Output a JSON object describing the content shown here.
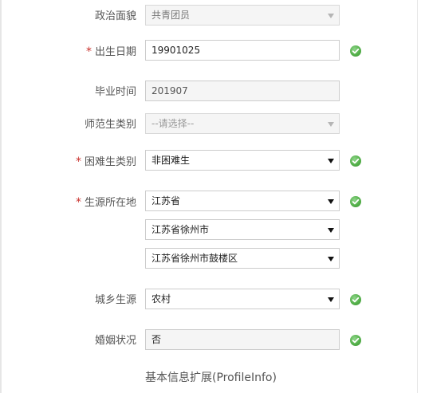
{
  "form": {
    "political": {
      "label": "政治面貌",
      "value": "共青团员"
    },
    "birth_date": {
      "label": "出生日期",
      "required_mark": "*",
      "value": "19901025"
    },
    "graduation_time": {
      "label": "毕业时间",
      "value": "201907"
    },
    "normal_student_type": {
      "label": "师范生类别",
      "value": "--请选择--"
    },
    "hardship_type": {
      "label": "困难生类别",
      "required_mark": "*",
      "value": "非困难生"
    },
    "origin": {
      "label": "生源所在地",
      "required_mark": "*",
      "province": "江苏省",
      "city": "江苏省徐州市",
      "district": "江苏省徐州市鼓楼区"
    },
    "urban_rural": {
      "label": "城乡生源",
      "value": "农村"
    },
    "marital_status": {
      "label": "婚姻状况",
      "value": "否"
    }
  },
  "section_footer": "基本信息扩展(ProfileInfo)",
  "colors": {
    "required": "#c9302c",
    "valid_icon": "#54b04a",
    "border": "#cccccc"
  },
  "icons": {
    "valid": "check-circle-icon",
    "dropdown": "chevron-down-icon"
  }
}
